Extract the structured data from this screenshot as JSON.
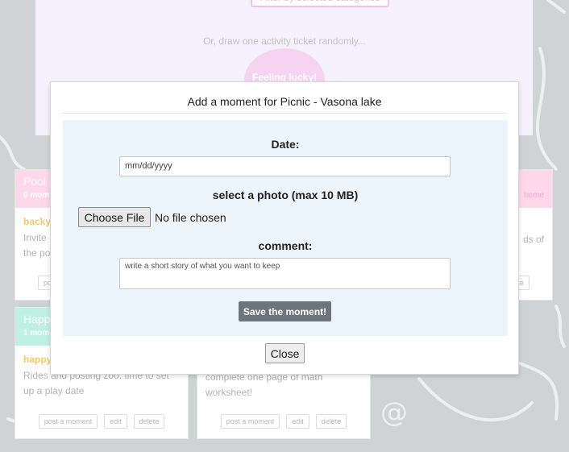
{
  "background": {
    "filter_button_label": "Filter by selected categories",
    "draw_text": "Or, draw one activity ticket randomly...",
    "lucky_button_label": "Feeling lucky!"
  },
  "cards": [
    {
      "title": "Pool p",
      "count": "0 mom",
      "category": "backy",
      "desc": "Invite\nthe po",
      "actions": [
        "po"
      ],
      "color": "#fdd8ea"
    },
    {
      "title": "Happy",
      "count": "1 mom",
      "category": "happy",
      "desc": "Rides and posting zoo. time to set up a play date",
      "actions": [
        "post a moment",
        "edit",
        "delete"
      ],
      "color": "#bff0e4"
    },
    {
      "title": "",
      "count": "",
      "category": "",
      "desc": "complete one page of math worksheet!",
      "actions": [
        "post a moment",
        "edit",
        "delete"
      ],
      "color": "#ffffff"
    },
    {
      "title": "",
      "count": "home",
      "category": "",
      "desc": "ds of",
      "actions": [
        "te"
      ],
      "color": "#fdd8ea"
    }
  ],
  "modal": {
    "title": "Add a moment for Picnic - Vasona lake",
    "date_label": "Date:",
    "date_placeholder": "mm/dd/yyyy",
    "photo_label": "select a photo (max 10 MB)",
    "choose_file_label": "Choose File",
    "no_file_text": "No file chosen",
    "comment_label": "comment:",
    "comment_placeholder": "write a short story of what you want to keep",
    "save_label": "Save the moment!",
    "close_label": "Close"
  }
}
